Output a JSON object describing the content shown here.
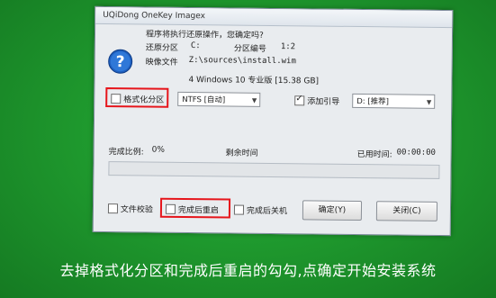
{
  "window": {
    "title": "UQiDong OneKey Imagex"
  },
  "message": {
    "question": "程序将执行还原操作，您确定吗?",
    "restore_partition_label": "还原分区",
    "restore_partition_value": "C:",
    "partition_number_label": "分区编号",
    "partition_number_value": "1:2",
    "image_file_label": "映像文件",
    "image_file_value": "Z:\\sources\\install.wim",
    "image_detail": "4 Windows 10 专业版 [15.38 GB]"
  },
  "options": {
    "format_partition": {
      "label": "格式化分区",
      "checked": false
    },
    "filesystem_select": "NTFS [自动]",
    "add_boot": {
      "label": "添加引导",
      "checked": true
    },
    "boot_drive_select": "D: [推荐]"
  },
  "progress": {
    "complete_ratio_label": "完成比例:",
    "complete_ratio_value": "0%",
    "remaining_time_label": "剩余时间",
    "elapsed_time_label": "已用时间:",
    "elapsed_time_value": "00:00:00",
    "fraction": 0
  },
  "footer": {
    "verify_file": {
      "label": "文件校验",
      "checked": false
    },
    "reboot_after": {
      "label": "完成后重启",
      "checked": false
    },
    "shutdown_after": {
      "label": "完成后关机",
      "checked": false
    },
    "ok_button": "确定(Y)",
    "close_button": "关闭(C)"
  },
  "caption": "去掉格式化分区和完成后重启的勾勾,点确定开始安装系统",
  "colors": {
    "highlight_box": "#e6151b",
    "background": "#1f9a2e"
  }
}
